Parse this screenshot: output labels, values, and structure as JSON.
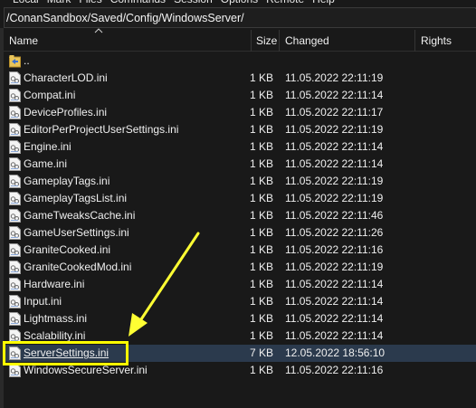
{
  "menu": [
    "Local",
    "Mark",
    "Files",
    "Commands",
    "Session",
    "Options",
    "Remote",
    "Help"
  ],
  "path": "/ConanSandbox/Saved/Config/WindowsServer/",
  "columns": {
    "name": "Name",
    "size": "Size",
    "changed": "Changed",
    "rights": "Rights"
  },
  "colors": {
    "highlight": "#ffff00",
    "arrow": "#ffff33",
    "selection": "#2b3a4d",
    "background": "#191919"
  },
  "files": [
    {
      "name": "..",
      "size": "",
      "changed": "",
      "icon": "parent-folder-icon"
    },
    {
      "name": "CharacterLOD.ini",
      "size": "1 KB",
      "changed": "11.05.2022 22:11:19",
      "icon": "ini-file-icon"
    },
    {
      "name": "Compat.ini",
      "size": "1 KB",
      "changed": "11.05.2022 22:11:14",
      "icon": "ini-file-icon"
    },
    {
      "name": "DeviceProfiles.ini",
      "size": "1 KB",
      "changed": "11.05.2022 22:11:17",
      "icon": "ini-file-icon"
    },
    {
      "name": "EditorPerProjectUserSettings.ini",
      "size": "1 KB",
      "changed": "11.05.2022 22:11:19",
      "icon": "ini-file-icon"
    },
    {
      "name": "Engine.ini",
      "size": "1 KB",
      "changed": "11.05.2022 22:11:14",
      "icon": "ini-file-icon"
    },
    {
      "name": "Game.ini",
      "size": "1 KB",
      "changed": "11.05.2022 22:11:14",
      "icon": "ini-file-icon"
    },
    {
      "name": "GameplayTags.ini",
      "size": "1 KB",
      "changed": "11.05.2022 22:11:19",
      "icon": "ini-file-icon"
    },
    {
      "name": "GameplayTagsList.ini",
      "size": "1 KB",
      "changed": "11.05.2022 22:11:19",
      "icon": "ini-file-icon"
    },
    {
      "name": "GameTweaksCache.ini",
      "size": "1 KB",
      "changed": "11.05.2022 22:11:46",
      "icon": "ini-file-icon"
    },
    {
      "name": "GameUserSettings.ini",
      "size": "1 KB",
      "changed": "11.05.2022 22:11:26",
      "icon": "ini-file-icon"
    },
    {
      "name": "GraniteCooked.ini",
      "size": "1 KB",
      "changed": "11.05.2022 22:11:16",
      "icon": "ini-file-icon"
    },
    {
      "name": "GraniteCookedMod.ini",
      "size": "1 KB",
      "changed": "11.05.2022 22:11:19",
      "icon": "ini-file-icon"
    },
    {
      "name": "Hardware.ini",
      "size": "1 KB",
      "changed": "11.05.2022 22:11:14",
      "icon": "ini-file-icon"
    },
    {
      "name": "Input.ini",
      "size": "1 KB",
      "changed": "11.05.2022 22:11:14",
      "icon": "ini-file-icon"
    },
    {
      "name": "Lightmass.ini",
      "size": "1 KB",
      "changed": "11.05.2022 22:11:14",
      "icon": "ini-file-icon"
    },
    {
      "name": "Scalability.ini",
      "size": "1 KB",
      "changed": "11.05.2022 22:11:14",
      "icon": "ini-file-icon"
    },
    {
      "name": "ServerSettings.ini",
      "size": "7 KB",
      "changed": "12.05.2022 18:56:10",
      "icon": "ini-file-icon",
      "selected": true
    },
    {
      "name": "WindowsSecureServer.ini",
      "size": "1 KB",
      "changed": "11.05.2022 22:11:16",
      "icon": "ini-file-icon"
    }
  ]
}
